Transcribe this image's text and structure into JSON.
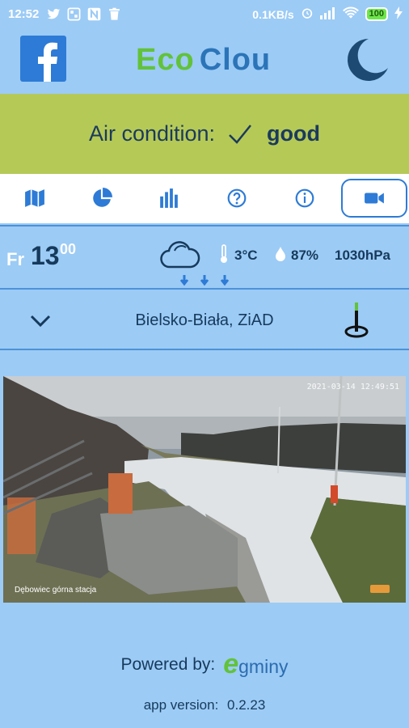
{
  "status_bar": {
    "time": "12:52",
    "net_speed": "0.1KB/s",
    "battery": "100",
    "notification_icons": [
      "twitter-icon",
      "grid-app-icon",
      "n-app-icon",
      "trash-icon"
    ],
    "system_icons": [
      "alarm-icon",
      "signal-icon",
      "wifi-icon",
      "battery-icon",
      "charging-icon"
    ]
  },
  "header": {
    "brand_part1": "Eco",
    "brand_part2": "Clou",
    "left_icon": "facebook-icon",
    "right_icon": "moon-icon"
  },
  "air": {
    "label": "Air condition:",
    "status": "good",
    "icon": "checkmark-icon"
  },
  "tabs": [
    {
      "icon": "map-icon",
      "active": false
    },
    {
      "icon": "pie-chart-icon",
      "active": false
    },
    {
      "icon": "bar-chart-icon",
      "active": false
    },
    {
      "icon": "help-icon",
      "active": false
    },
    {
      "icon": "info-icon",
      "active": false
    },
    {
      "icon": "video-camera-icon",
      "active": true
    }
  ],
  "weather": {
    "day": "Fr",
    "hour": "13",
    "minutes": "00",
    "icon": "cloud-icon",
    "temperature": "3°C",
    "humidity": "87%",
    "pressure": "1030hPa"
  },
  "station": {
    "name": "Bielsko-Biała, ZiAD",
    "icon": "location-pin-icon"
  },
  "webcam": {
    "timestamp": "2021-03-14 12:49:51",
    "caption": "Dębowiec górna stacja"
  },
  "footer": {
    "powered_label": "Powered by:",
    "logo_e": "e",
    "logo_rest": "gminy",
    "version_label": "app version:",
    "version": "0.2.23"
  },
  "colors": {
    "background": "#9ccbf5",
    "air_good": "#b5c957",
    "brand_green": "#62c23a",
    "brand_blue": "#2b74b8",
    "accent": "#2d7bd6"
  }
}
